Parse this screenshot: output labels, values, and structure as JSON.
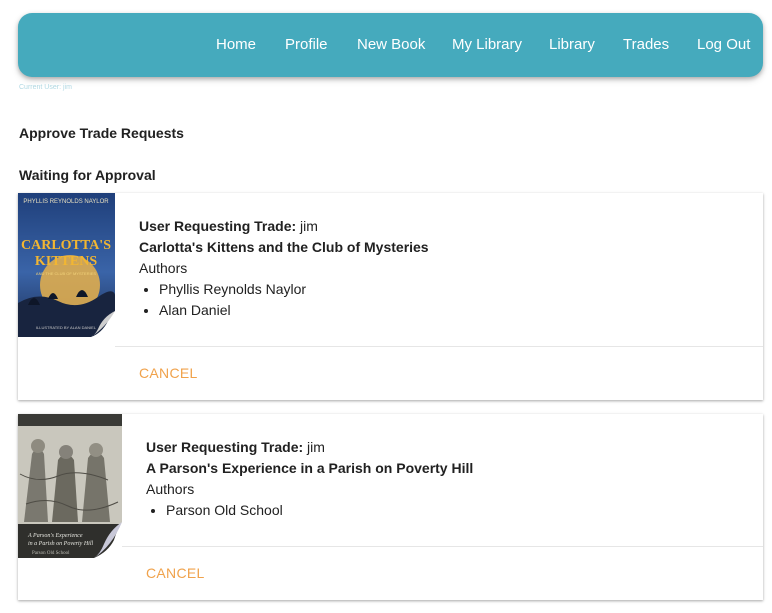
{
  "nav": {
    "items": [
      "Home",
      "Profile",
      "New Book",
      "My Library",
      "Library",
      "Trades",
      "Log Out"
    ]
  },
  "current_user": "Current User: jim",
  "page": {
    "heading": "Approve Trade Requests",
    "subheading": "Waiting for Approval"
  },
  "trades": [
    {
      "requesting_label": "User Requesting Trade:",
      "requesting_user": "jim",
      "title": "Carlotta's Kittens and the Club of Mysteries",
      "authors_label": "Authors",
      "authors": [
        "Phyllis Reynolds Naylor",
        "Alan Daniel"
      ],
      "cancel_label": "CANCEL",
      "cover": {
        "top_text": "PHYLLIS REYNOLDS NAYLOR",
        "title_line1": "CARLOTTA'S",
        "title_line2": "KITTENS",
        "subtitle": "AND THE CLUB OF MYSTERIES",
        "bottom_text": "ILLUSTRATED BY ALAN DANIEL"
      }
    },
    {
      "requesting_label": "User Requesting Trade:",
      "requesting_user": "jim",
      "title": "A Parson's Experience in a Parish on Poverty Hill",
      "authors_label": "Authors",
      "authors": [
        "Parson Old School"
      ],
      "cancel_label": "CANCEL",
      "cover": {
        "caption_line1": "A Parson's Experience",
        "caption_line2": "in a Parish on Poverty Hill",
        "caption_line3": "Parson Old School"
      }
    }
  ],
  "colors": {
    "navbar": "#45aabd",
    "cancel": "#f0a24b",
    "cover1_sky": "#2b4a8a",
    "cover1_title": "#f2b632"
  }
}
